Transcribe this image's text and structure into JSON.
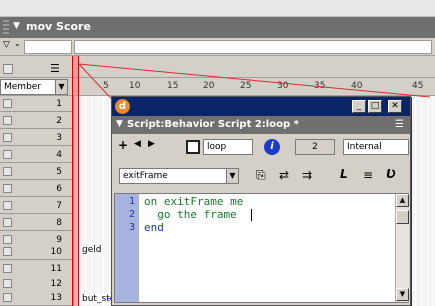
{
  "score": {
    "title": "mov Score",
    "member_label": "Member",
    "frame_numbers": [
      "5",
      "10",
      "15",
      "20",
      "25",
      "30",
      "35",
      "40",
      "45"
    ],
    "channels": [
      "1",
      "2",
      "3",
      "4",
      "5",
      "6",
      "7",
      "8",
      "9",
      "10",
      "11",
      "12",
      "13"
    ],
    "sprites": [
      {
        "label": "geld"
      },
      {
        "label": "but_stop"
      }
    ]
  },
  "script_window": {
    "title": "Script:Behavior Script 2:loop *",
    "member_name": "loop",
    "cast_number": "2",
    "cast_lib": "Internal",
    "handler": "exitFrame",
    "code_lines": [
      {
        "num": "1",
        "text": "on exitFrame me"
      },
      {
        "num": "2",
        "text": "  go the frame"
      },
      {
        "num": "3",
        "text": "end"
      }
    ]
  },
  "colors": {
    "titlebar": "#0a246a",
    "panel_header": "#6f6f6f",
    "keyword": "#1a3aa8",
    "code_text": "#1a7a2a",
    "playhead": "#e06060"
  }
}
